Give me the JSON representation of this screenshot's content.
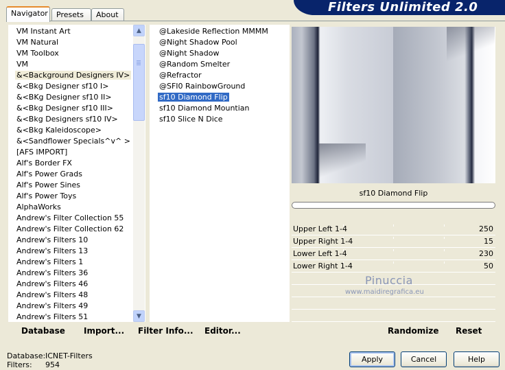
{
  "banner_title": "Filters Unlimited 2.0",
  "tabs": [
    "Navigator",
    "Presets",
    "About"
  ],
  "categories": [
    "VM Instant Art",
    "VM Natural",
    "VM Toolbox",
    "VM",
    "&<Background Designers IV>",
    "&<Bkg Designer sf10 I>",
    "&<BKg Designer sf10 II>",
    "&<Bkg Designer sf10 III>",
    "&<Bkg Designers sf10 IV>",
    "&<Bkg Kaleidoscope>",
    "&<Sandflower Specials^v^ >",
    "[AFS IMPORT]",
    "Alf's Border FX",
    "Alf's Power Grads",
    "Alf's Power Sines",
    "Alf's Power Toys",
    "AlphaWorks",
    "Andrew's Filter Collection 55",
    "Andrew's Filter Collection 62",
    "Andrew's Filters 10",
    "Andrew's Filters 13",
    "Andrew's Filters 1",
    "Andrew's Filters 36",
    "Andrew's Filters 46",
    "Andrew's Filters 48",
    "Andrew's Filters 49",
    "Andrew's Filters 51"
  ],
  "selected_category_index": 4,
  "filters": [
    "@Lakeside Reflection MMMM",
    "@Night Shadow Pool",
    "@Night Shadow",
    "@Random Smelter",
    "@Refractor",
    "@SFI0 RainbowGround",
    "sf10 Diamond Flip",
    "sf10 Diamond Mountian",
    "sf10 Slice N Dice"
  ],
  "selected_filter_index": 6,
  "filter_name": "sf10 Diamond Flip",
  "parameters": [
    {
      "label": "Upper Left 1-4",
      "value": "250"
    },
    {
      "label": "Upper Right 1-4",
      "value": "15"
    },
    {
      "label": "Lower Left 1-4",
      "value": "230"
    },
    {
      "label": "Lower Right 1-4",
      "value": "50"
    }
  ],
  "watermark": {
    "name": "Pinuccia",
    "url": "www.maidiregrafica.eu"
  },
  "bottom_links": {
    "database": "Database",
    "import": "Import...",
    "filter_info": "Filter Info...",
    "editor": "Editor...",
    "randomize": "Randomize",
    "reset": "Reset"
  },
  "info": {
    "database_label": "Database:",
    "database_value": "ICNET-Filters",
    "filters_label": "Filters:",
    "filters_value": "954"
  },
  "buttons": {
    "apply": "Apply",
    "cancel": "Cancel",
    "help": "Help"
  }
}
